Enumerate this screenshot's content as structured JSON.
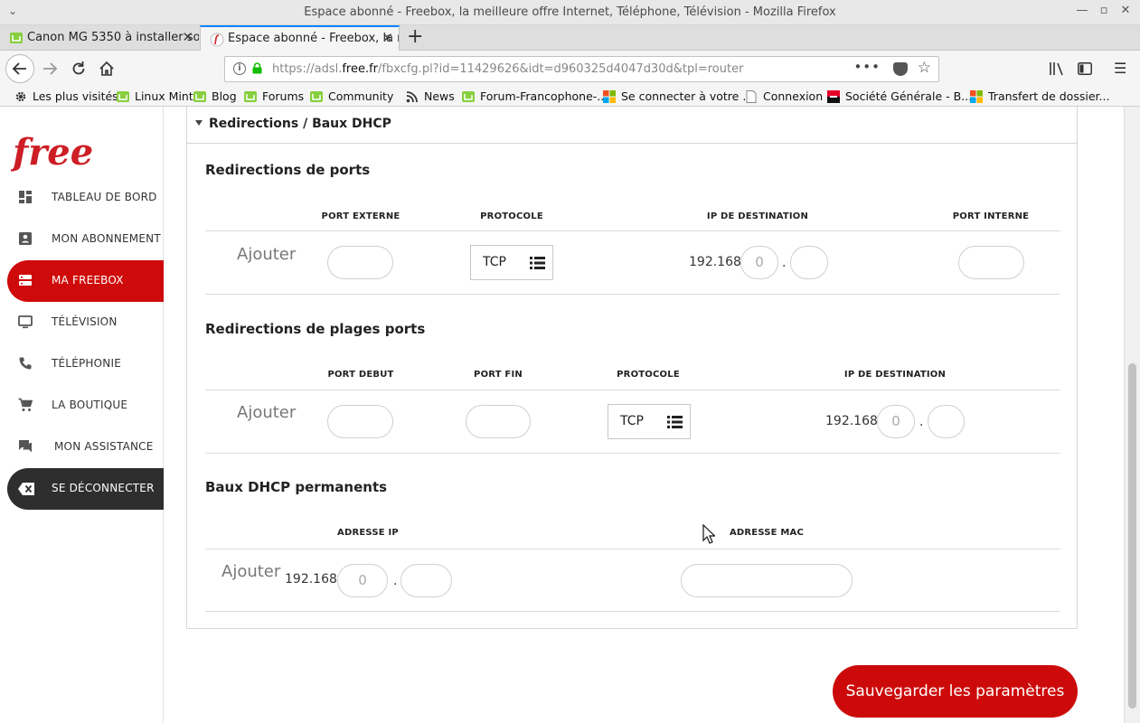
{
  "window": {
    "title": "Espace abonné - Freebox, la meilleure offre Internet, Téléphone, Télévision - Mozilla Firefox"
  },
  "tabs": [
    {
      "label": "Canon MG 5350 à installer so",
      "active": false
    },
    {
      "label": "Espace abonné - Freebox, la m",
      "active": true
    }
  ],
  "new_tab_label": "+",
  "url": {
    "prefix": "https://adsl.",
    "domain": "free.fr",
    "path": "/fbxcfg.pl?id=11429626&idt=d960325d4047d30d&tpl=router"
  },
  "bookmarks": [
    {
      "label": "Les plus visités",
      "icon": "gear-icon"
    },
    {
      "label": "Linux Mint",
      "icon": "mint-icon"
    },
    {
      "label": "Blog",
      "icon": "mint-icon"
    },
    {
      "label": "Forums",
      "icon": "mint-icon"
    },
    {
      "label": "Community",
      "icon": "mint-icon"
    },
    {
      "label": "News",
      "icon": "rss-icon"
    },
    {
      "label": "Forum-Francophone-...",
      "icon": "mint-icon"
    },
    {
      "label": "Se connecter à votre ...",
      "icon": "microsoft-icon"
    },
    {
      "label": "Connexion",
      "icon": "page-icon"
    },
    {
      "label": "Société Générale - B...",
      "icon": "sg-icon"
    },
    {
      "label": "Transfert de dossier...",
      "icon": "microsoft-icon"
    }
  ],
  "sidebar": {
    "logo_text": "free",
    "items": [
      {
        "label": "TABLEAU DE BORD",
        "icon": "dashboard-icon",
        "state": "normal"
      },
      {
        "label": "MON ABONNEMENT",
        "icon": "account-card-icon",
        "state": "normal"
      },
      {
        "label": "MA FREEBOX",
        "icon": "server-icon",
        "state": "active"
      },
      {
        "label": "TÉLÉVISION",
        "icon": "tv-icon",
        "state": "normal"
      },
      {
        "label": "TÉLÉPHONIE",
        "icon": "phone-icon",
        "state": "normal"
      },
      {
        "label": "LA BOUTIQUE",
        "icon": "cart-icon",
        "state": "normal"
      },
      {
        "label": "MON ASSISTANCE",
        "icon": "chat-icon",
        "state": "normal"
      },
      {
        "label": "SE DÉCONNECTER",
        "icon": "logout-icon",
        "state": "dark"
      }
    ]
  },
  "panel": {
    "title": "Redirections / Baux DHCP",
    "ports": {
      "title": "Redirections de ports",
      "headers": [
        "PORT EXTERNE",
        "PROTOCOLE",
        "IP DE DESTINATION",
        "PORT INTERNE"
      ],
      "add_label": "Ajouter",
      "protocol": "TCP",
      "ip_prefix": "192.168.",
      "ip_placeholder": "0",
      "dot": "."
    },
    "ranges": {
      "title": "Redirections de plages ports",
      "headers": [
        "PORT DEBUT",
        "PORT FIN",
        "PROTOCOLE",
        "IP DE DESTINATION"
      ],
      "add_label": "Ajouter",
      "protocol": "TCP",
      "ip_prefix": "192.168.",
      "ip_placeholder": "0",
      "dot": "."
    },
    "dhcp": {
      "title": "Baux DHCP permanents",
      "headers": [
        "ADRESSE IP",
        "ADRESSE MAC"
      ],
      "add_label": "Ajouter",
      "ip_prefix": "192.168.",
      "ip_placeholder": "0",
      "dot": "."
    }
  },
  "save_button": "Sauvegarder les paramètres",
  "colors": {
    "brand_red": "#cc0a0a",
    "dark": "#2e2e2e",
    "firefox_blue": "#0a84ff"
  }
}
